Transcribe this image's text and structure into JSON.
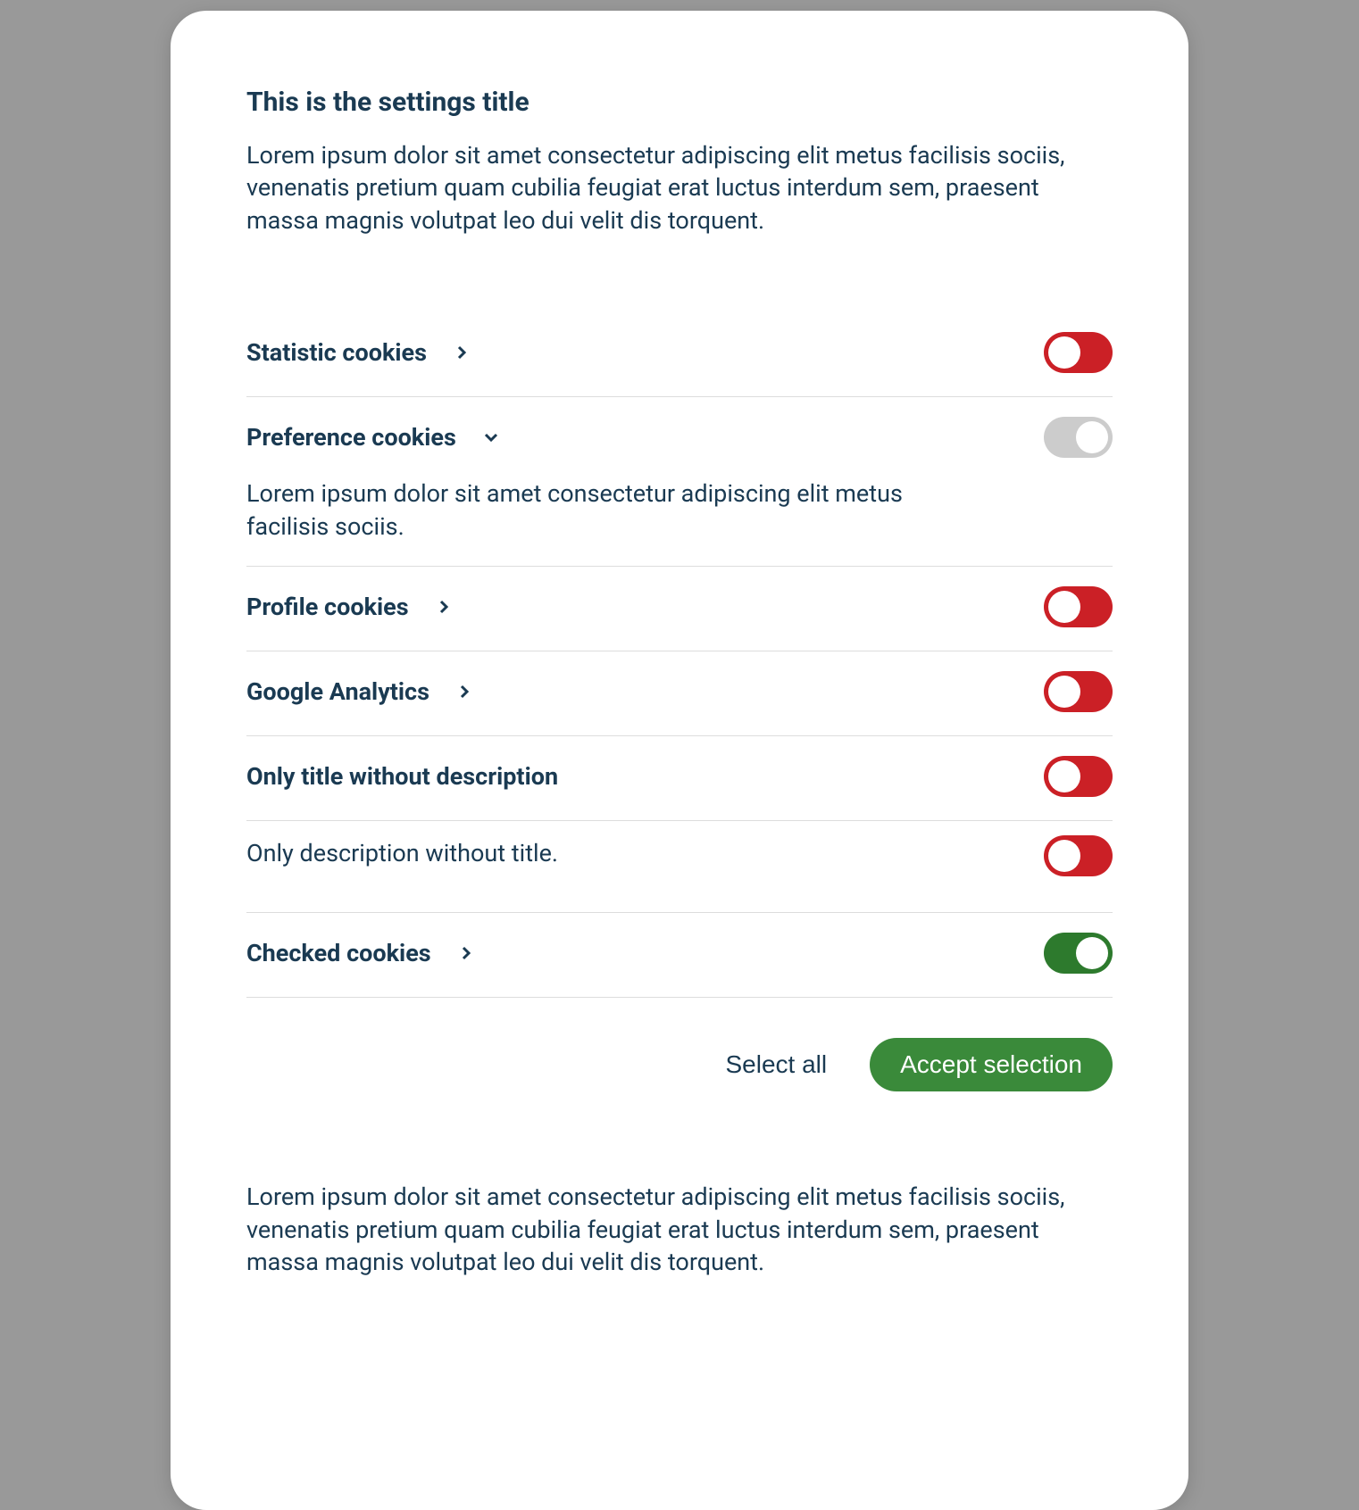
{
  "header": {
    "title": "This is the settings title",
    "description": "Lorem ipsum dolor sit amet consectetur adipiscing elit metus facilisis sociis, venenatis pretium quam cubilia feugiat erat luctus interdum sem, praesent massa magnis volutpat leo dui velit dis torquent."
  },
  "cookies": [
    {
      "title": "Statistic cookies",
      "expanded": false,
      "state": "off"
    },
    {
      "title": "Preference cookies",
      "expanded": true,
      "description": "Lorem ipsum dolor sit amet consectetur adipiscing elit metus facilisis sociis.",
      "state": "neutral"
    },
    {
      "title": "Profile cookies",
      "expanded": false,
      "state": "off"
    },
    {
      "title": "Google Analytics",
      "expanded": false,
      "state": "off"
    },
    {
      "title": "Only title without description",
      "state": "off"
    },
    {
      "description": "Only description without title.",
      "state": "off"
    },
    {
      "title": "Checked cookies",
      "expanded": false,
      "state": "on"
    }
  ],
  "actions": {
    "select_all": "Select all",
    "accept": "Accept selection"
  },
  "footer": {
    "text": "Lorem ipsum dolor sit amet consectetur adipiscing elit metus facilisis sociis, venenatis pretium quam cubilia feugiat erat luctus interdum sem, praesent massa magnis volutpat leo dui velit dis torquent."
  }
}
